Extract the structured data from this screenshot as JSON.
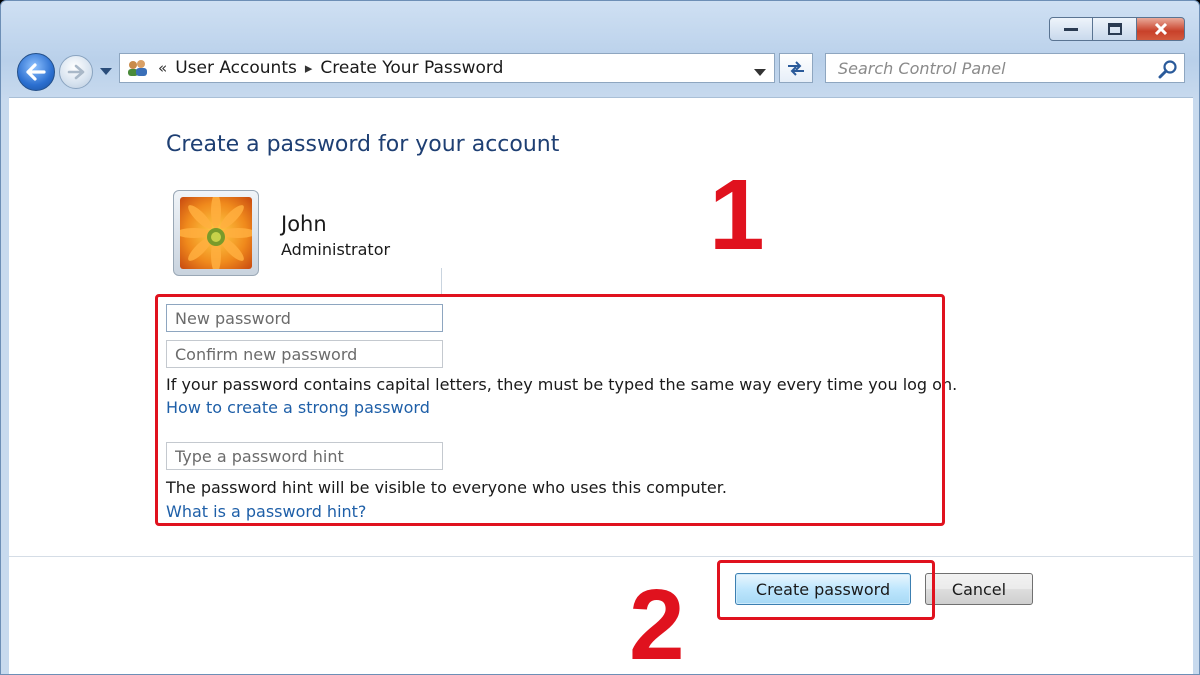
{
  "window": {
    "minimize_icon": "minimize-icon",
    "maximize_icon": "maximize-icon",
    "close_icon": "close-icon"
  },
  "nav": {
    "back_icon": "back-arrow-icon",
    "forward_icon": "forward-arrow-icon",
    "address": {
      "overflow": "«",
      "crumbs": [
        "User Accounts",
        "Create Your Password"
      ],
      "separator": "▸"
    },
    "refresh_icon": "refresh-icon",
    "search_placeholder": "Search Control Panel"
  },
  "page": {
    "heading": "Create a password for your account",
    "user": {
      "name": "John",
      "role": "Administrator"
    },
    "fields": {
      "new_password_placeholder": "New password",
      "confirm_password_placeholder": "Confirm new password",
      "hint_placeholder": "Type a password hint"
    },
    "caps_note": "If your password contains capital letters, they must be typed the same way every time you log on.",
    "strong_password_link": "How to create a strong password",
    "hint_note": "The password hint will be visible to everyone who uses this computer.",
    "hint_link": "What is a password hint?",
    "buttons": {
      "create": "Create password",
      "cancel": "Cancel"
    }
  },
  "annotations": {
    "marker_1": "1",
    "marker_2": "2",
    "highlight_color": "#e0121e"
  }
}
